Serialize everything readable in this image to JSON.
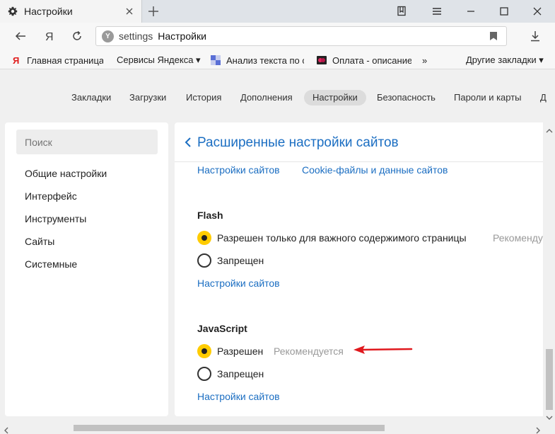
{
  "colors": {
    "accent": "#1b6ec2",
    "radio_checked": "#ffcc00",
    "annotation": "#e0191e"
  },
  "tab": {
    "title": "Настройки",
    "icon": "gear-icon"
  },
  "address_bar": {
    "url": "settings",
    "page_title": "Настройки"
  },
  "bookmarks": [
    {
      "label": "Главная страница",
      "icon": "yandex-icon"
    },
    {
      "label": "Сервисы Яндекса ▾",
      "icon": ""
    },
    {
      "label": "Анализ текста по с",
      "icon": "site-icon"
    },
    {
      "label": "Оплата - описание",
      "icon": "site-icon"
    },
    {
      "label": "»",
      "icon": ""
    },
    {
      "label": "Другие закладки ▾",
      "icon": ""
    }
  ],
  "settings_nav": [
    {
      "label": "Закладки"
    },
    {
      "label": "Загрузки"
    },
    {
      "label": "История"
    },
    {
      "label": "Дополнения"
    },
    {
      "label": "Настройки",
      "active": true
    },
    {
      "label": "Безопасность"
    },
    {
      "label": "Пароли и карты"
    },
    {
      "label": "Д"
    }
  ],
  "sidebar": {
    "search_placeholder": "Поиск",
    "items": [
      {
        "label": "Общие настройки"
      },
      {
        "label": "Интерфейс"
      },
      {
        "label": "Инструменты"
      },
      {
        "label": "Сайты"
      },
      {
        "label": "Системные"
      }
    ]
  },
  "main": {
    "title": "Расширенные настройки сайтов",
    "sub_links": [
      "Настройки сайтов",
      "Cookie-файлы и данные сайтов"
    ],
    "flash": {
      "title": "Flash",
      "option_allowed": "Разрешен только для важного содержимого страницы",
      "option_allowed_hint": "Рекоменду",
      "option_blocked": "Запрещен",
      "site_settings_link": "Настройки сайтов"
    },
    "javascript": {
      "title": "JavaScript",
      "option_allowed": "Разрешен",
      "option_allowed_hint": "Рекомендуется",
      "option_blocked": "Запрещен",
      "site_settings_link": "Настройки сайтов"
    }
  }
}
